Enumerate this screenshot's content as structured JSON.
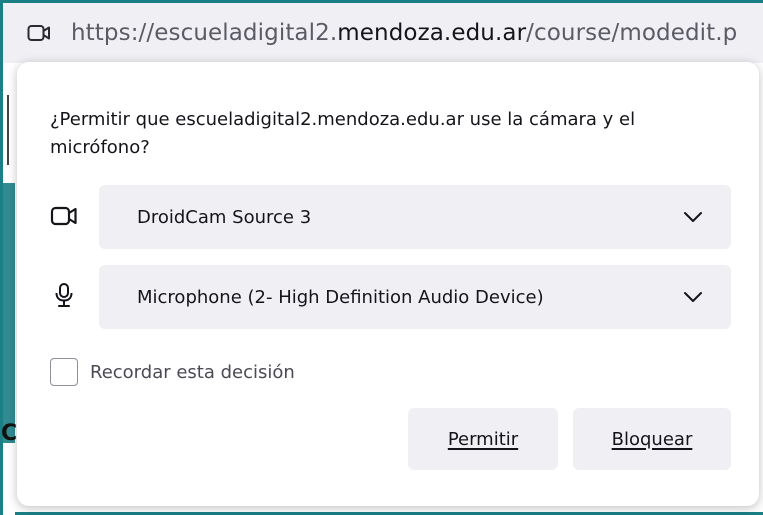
{
  "url": {
    "prefix": "https://escueladigital2.",
    "host": "mendoza.edu.ar",
    "suffix": "/course/modedit.p"
  },
  "icons": {
    "urlbar": "camera-icon",
    "camera_row": "camera-icon",
    "mic_row": "microphone-icon",
    "dropdown": "chevron-down-icon"
  },
  "prompt": {
    "question": "¿Permitir que escueladigital2.mendoza.edu.ar use la cámara y el micrófono?",
    "camera_select": "DroidCam Source 3",
    "microphone_select": "Microphone (2- High Definition Audio Device)",
    "remember_label": "Recordar esta decisión",
    "allow_label": "Permitir",
    "block_label": "Bloquear"
  },
  "background": {
    "edge_glyph": "C"
  },
  "colors": {
    "frame": "#1b7f86",
    "control_bg": "#f0f0f4",
    "text": "#15141a"
  }
}
